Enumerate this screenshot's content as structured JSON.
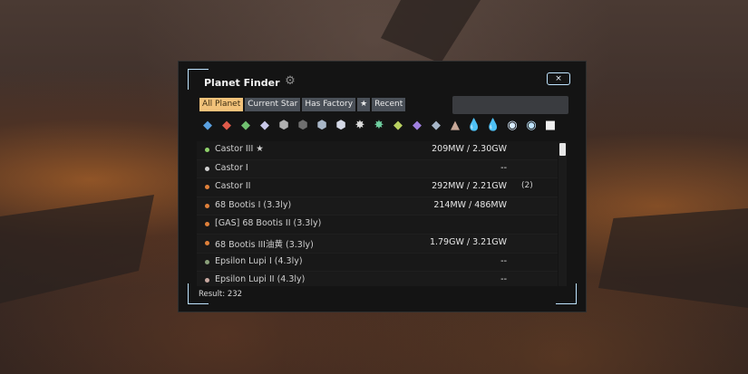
{
  "window": {
    "title": "Planet Finder",
    "close_label": "×",
    "gear_icon": "gear-icon"
  },
  "tabs": [
    {
      "label": "All Planet",
      "active": true
    },
    {
      "label": "Current Star",
      "active": false
    },
    {
      "label": "Has Factory",
      "active": false
    },
    {
      "label": "★",
      "active": false
    },
    {
      "label": "Recent",
      "active": false
    }
  ],
  "search": {
    "value": "",
    "placeholder": ""
  },
  "resource_icons": [
    {
      "name": "iron-ore-icon",
      "glyph": "◆",
      "color": "#5aa0e0"
    },
    {
      "name": "copper-ore-icon",
      "glyph": "◆",
      "color": "#e05a4a"
    },
    {
      "name": "silicon-ore-icon",
      "glyph": "◆",
      "color": "#70c070"
    },
    {
      "name": "titanium-ore-icon",
      "glyph": "◆",
      "color": "#c8c8e8"
    },
    {
      "name": "stone-icon",
      "glyph": "⬢",
      "color": "#b0b0b0"
    },
    {
      "name": "coal-icon",
      "glyph": "⬢",
      "color": "#6f6f6f"
    },
    {
      "name": "ore-rock-icon",
      "glyph": "⬢",
      "color": "#a9b7c8"
    },
    {
      "name": "ice-rock-icon",
      "glyph": "⬢",
      "color": "#d4d9e6"
    },
    {
      "name": "fire-ice-icon",
      "glyph": "✸",
      "color": "#dcdcdc"
    },
    {
      "name": "kimberlite-icon",
      "glyph": "✸",
      "color": "#6fcfa0"
    },
    {
      "name": "fractal-silicon-icon",
      "glyph": "◆",
      "color": "#b8d060"
    },
    {
      "name": "optical-grating-icon",
      "glyph": "◆",
      "color": "#a080e0"
    },
    {
      "name": "spiniform-icon",
      "glyph": "◆",
      "color": "#a7b6c8"
    },
    {
      "name": "unipolar-magnet-icon",
      "glyph": "▲",
      "color": "#c8a898"
    },
    {
      "name": "water-icon",
      "glyph": "💧",
      "color": "#bcd4f0"
    },
    {
      "name": "crude-oil-icon",
      "glyph": "💧",
      "color": "#e8c060"
    },
    {
      "name": "hydrogen-icon",
      "glyph": "◉",
      "color": "#d8ecff"
    },
    {
      "name": "deuterium-icon",
      "glyph": "◉",
      "color": "#bfe4ff"
    },
    {
      "name": "sulfuric-acid-icon",
      "glyph": "■",
      "color": "#f0f0f0"
    }
  ],
  "planets": [
    {
      "name": "Castor III ★",
      "power": "209MW / 2.30GW",
      "extra": "",
      "dot": "#8fd16a"
    },
    {
      "name": "Castor I",
      "power": "--",
      "extra": "",
      "dot": "#d0d0d0"
    },
    {
      "name": "Castor II",
      "power": "292MW / 2.21GW",
      "extra": "(2)",
      "dot": "#e0803a"
    },
    {
      "name": "68 Bootis I  (3.3ly)",
      "power": "214MW / 486MW",
      "extra": "",
      "dot": "#e0803a"
    },
    {
      "name": "[GAS] 68 Bootis II  (3.3ly)",
      "power": "",
      "extra": "",
      "dot": "#e0803a"
    },
    {
      "name": "68 Bootis III油黄  (3.3ly)",
      "power": "1.79GW / 3.21GW",
      "extra": "",
      "dot": "#e0803a"
    },
    {
      "name": "Epsilon Lupi I  (4.3ly)",
      "power": "--",
      "extra": "",
      "dot": "#8aa07a"
    },
    {
      "name": "Epsilon Lupi II  (4.3ly)",
      "power": "--",
      "extra": "",
      "dot": "#c8a8a0"
    }
  ],
  "result": "Result: 232"
}
